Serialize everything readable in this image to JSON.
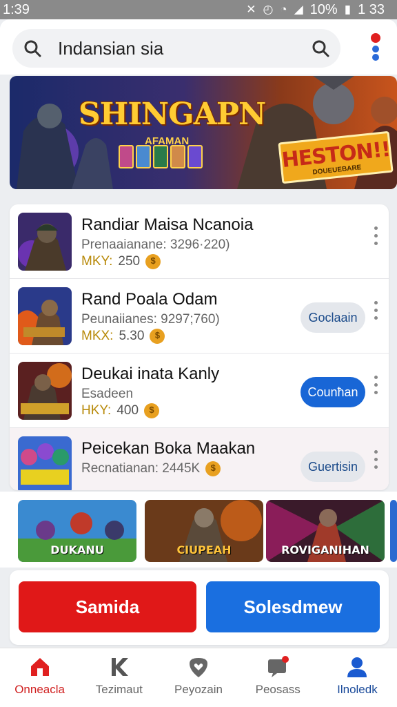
{
  "status_bar": {
    "time": "1:39",
    "battery": "10%",
    "extra_time": "1 33"
  },
  "search": {
    "value": "Indansian sia"
  },
  "banner": {
    "title": "SHINGAPN",
    "subtitle": "AFAMAN",
    "promo_title": "HESTON!!",
    "promo_sub": "DOUEUEBARE"
  },
  "list": {
    "items": [
      {
        "name": "Randiar Maisa Ncanoia",
        "meta": "Prenaaianane: 3296·220)",
        "price_label": "MKY:",
        "price": "250",
        "button": ""
      },
      {
        "name": "Rand Poala Odam",
        "meta": "Peunaiianes: 9297;760)",
        "price_label": "MKX:",
        "price": "5.30",
        "button": "Goclaain"
      },
      {
        "name": "Deukai inata Kanly",
        "meta": "Esadeen",
        "price_label": "HKY:",
        "price": "400",
        "button": "Counħan"
      },
      {
        "name": "Peicekan Boka Maakan",
        "meta": "Recnatianan: 2445K",
        "price_label": "",
        "price": "",
        "button": "Guertisin"
      }
    ]
  },
  "gallery": {
    "tiles": [
      {
        "caption": "DUKANU"
      },
      {
        "caption": "CIUPEAH"
      },
      {
        "caption": "ROVIGANIHAN"
      }
    ]
  },
  "actions": {
    "primary": "Samida",
    "secondary": "Solesdmew"
  },
  "bottom_nav": {
    "items": [
      {
        "label": "Onneacla",
        "icon": "home-icon"
      },
      {
        "label": "Tezimaut",
        "icon": "k-icon"
      },
      {
        "label": "Peyozain",
        "icon": "heart-shield-icon"
      },
      {
        "label": "Peosass",
        "icon": "chat-icon"
      },
      {
        "label": "Ilnoledk",
        "icon": "profile-icon"
      }
    ]
  },
  "colors": {
    "accent_red": "#e01818",
    "accent_blue": "#1a6fe0",
    "coin": "#e8a020"
  }
}
